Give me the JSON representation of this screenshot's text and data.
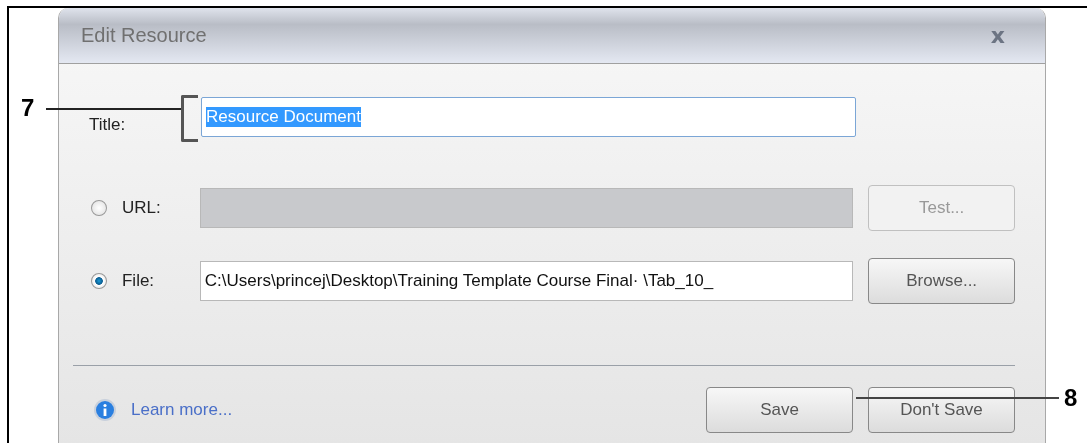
{
  "dialog": {
    "title": "Edit Resource",
    "close": "x"
  },
  "title_field": {
    "label": "Title:",
    "value": "Resource Document",
    "text_selected": true
  },
  "sources": [
    {
      "label": "URL:",
      "selected": false,
      "disabled": true,
      "button": {
        "label": "Test...",
        "disabled": true
      }
    },
    {
      "label": "File:",
      "selected": true,
      "value": "C:\\Users\\princej\\Desktop\\Training Template Course Final· \\Tab_10_",
      "disabled": false,
      "button": {
        "label": "Browse...",
        "disabled": false
      }
    }
  ],
  "footer": {
    "link": "Learn more...",
    "buttons": [
      {
        "label": "Save",
        "disabled": false
      },
      {
        "label": "Don't Save",
        "disabled": false
      }
    ]
  },
  "callouts": [
    {
      "number": "7"
    },
    {
      "number": "8"
    }
  ]
}
